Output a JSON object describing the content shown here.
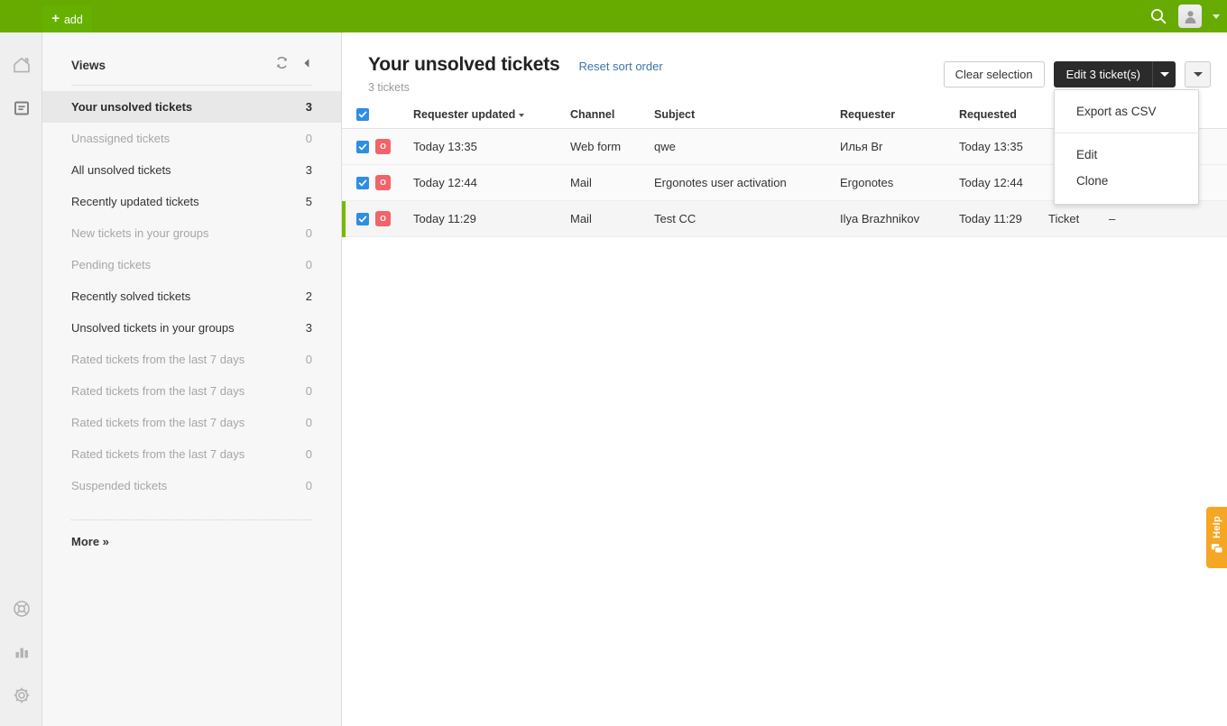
{
  "topbar": {
    "add_tab_label": "add",
    "add_tab_icon": "plus-icon",
    "search_icon": "search-icon",
    "avatar_icon": "user-avatar-icon",
    "profile_caret_icon": "chevron-down-icon",
    "background_color": "#68ab00"
  },
  "rail": {
    "items": [
      {
        "name": "home",
        "icon": "home-icon"
      },
      {
        "name": "tickets",
        "icon": "ticket-document-icon"
      },
      {
        "name": "support",
        "icon": "lifesaver-icon"
      },
      {
        "name": "reports",
        "icon": "bar-chart-icon"
      },
      {
        "name": "settings",
        "icon": "gear-icon"
      }
    ]
  },
  "sidebar": {
    "title": "Views",
    "refresh_icon": "refresh-icon",
    "collapse_icon": "chevron-left-icon",
    "more_label": "More »",
    "items": [
      {
        "label": "Your unsolved tickets",
        "count": "3",
        "state": "active"
      },
      {
        "label": "Unassigned tickets",
        "count": "0",
        "state": "dim"
      },
      {
        "label": "All unsolved tickets",
        "count": "3",
        "state": "enabled"
      },
      {
        "label": "Recently updated tickets",
        "count": "5",
        "state": "enabled"
      },
      {
        "label": "New tickets in your groups",
        "count": "0",
        "state": "dim"
      },
      {
        "label": "Pending tickets",
        "count": "0",
        "state": "dim"
      },
      {
        "label": "Recently solved tickets",
        "count": "2",
        "state": "enabled"
      },
      {
        "label": "Unsolved tickets in your groups",
        "count": "3",
        "state": "enabled"
      },
      {
        "label": "Rated tickets from the last 7 days",
        "count": "0",
        "state": "dim"
      },
      {
        "label": "Rated tickets from the last 7 days",
        "count": "0",
        "state": "dim"
      },
      {
        "label": "Rated tickets from the last 7 days",
        "count": "0",
        "state": "dim"
      },
      {
        "label": "Rated tickets from the last 7 days",
        "count": "0",
        "state": "dim"
      },
      {
        "label": "Suspended tickets",
        "count": "0",
        "state": "dim"
      }
    ]
  },
  "main": {
    "page_title": "Your unsolved tickets",
    "reset_sort_label": "Reset sort order",
    "ticket_count_label": "3 tickets",
    "clear_selection_label": "Clear selection",
    "edit_button_label": "Edit 3 ticket(s)",
    "edit_caret_icon": "chevron-down-icon",
    "more_caret_icon": "chevron-down-icon",
    "accent_green": "#7ab800",
    "checkbox_blue": "#2f8de4",
    "status_red": "#f2646a"
  },
  "menu": {
    "items_top": [
      {
        "label": "Export as CSV"
      }
    ],
    "items_bottom": [
      {
        "label": "Edit"
      },
      {
        "label": "Clone"
      }
    ]
  },
  "table": {
    "select_all_checked": true,
    "columns": [
      {
        "key": "requester_updated",
        "label": "Requester updated",
        "sorted": true,
        "sort_dir": "desc"
      },
      {
        "key": "channel",
        "label": "Channel"
      },
      {
        "key": "subject",
        "label": "Subject"
      },
      {
        "key": "requester",
        "label": "Requester"
      },
      {
        "key": "requested",
        "label": "Requested"
      }
    ],
    "rows": [
      {
        "checked": true,
        "status_icon": "open-status-icon",
        "status_glyph": "O",
        "requester_updated": "Today 13:35",
        "channel": "Web form",
        "subject": "qwe",
        "requester": "Илья Br",
        "requested": "Today 13:35",
        "type": "",
        "last": "",
        "accent": false
      },
      {
        "checked": true,
        "status_icon": "open-status-icon",
        "status_glyph": "O",
        "requester_updated": "Today 12:44",
        "channel": "Mail",
        "subject": "Ergonotes user activation",
        "requester": "Ergonotes",
        "requested": "Today 12:44",
        "type": "",
        "last": "",
        "accent": false
      },
      {
        "checked": true,
        "status_icon": "open-status-icon",
        "status_glyph": "O",
        "requester_updated": "Today 11:29",
        "channel": "Mail",
        "subject": "Test CC",
        "requester": "Ilya Brazhnikov",
        "requested": "Today 11:29",
        "type": "Ticket",
        "last": "–",
        "accent": true
      }
    ]
  },
  "help": {
    "label": "Help",
    "icon": "chat-bubbles-icon",
    "color": "#f5a623"
  }
}
